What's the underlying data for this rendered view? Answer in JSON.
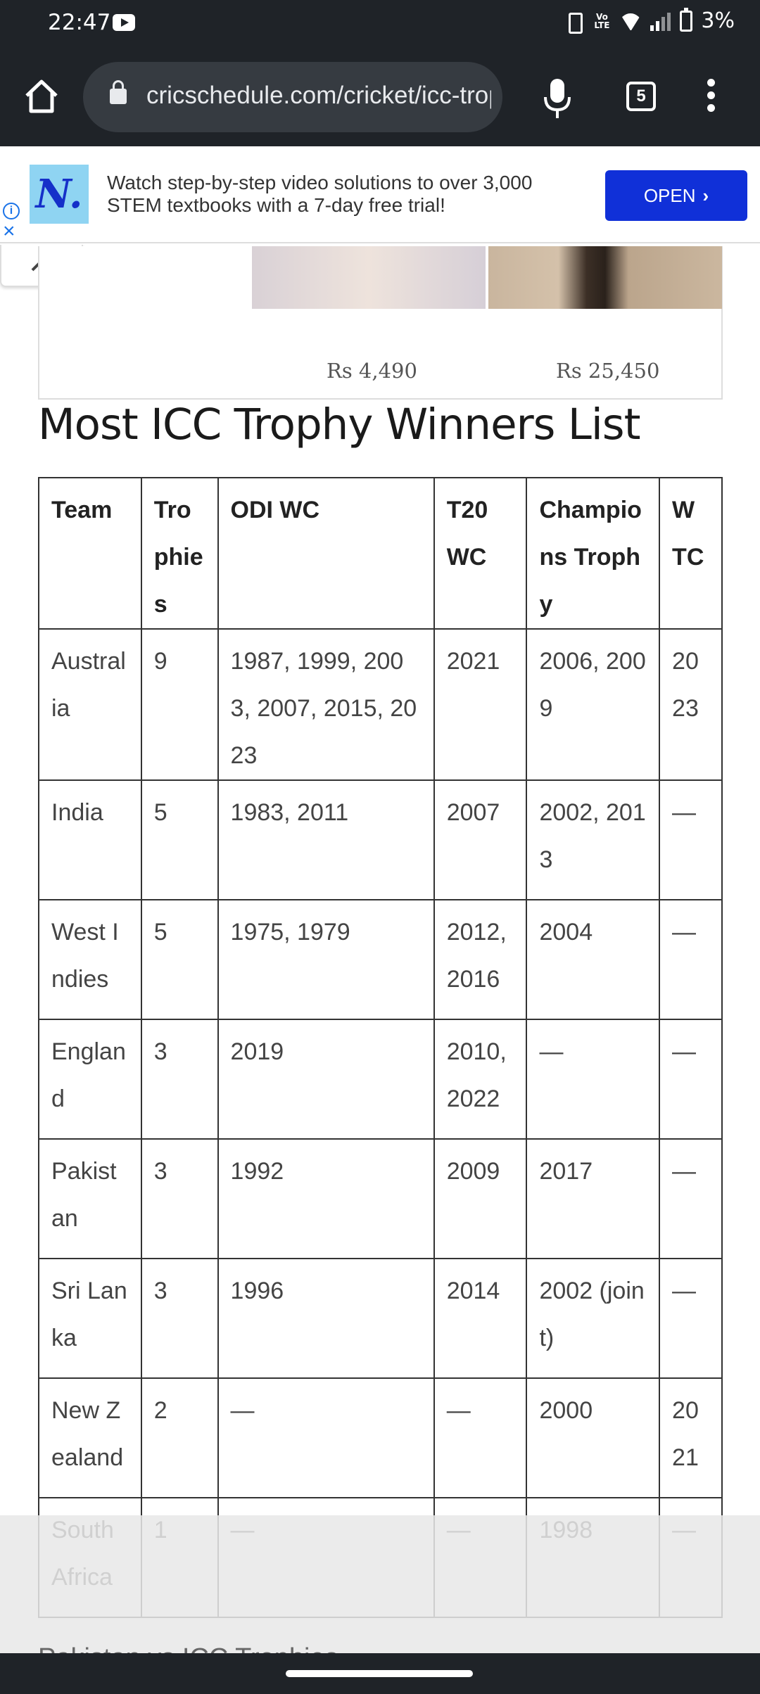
{
  "status_bar": {
    "time": "22:47",
    "volte": "Vo LTE",
    "battery": "3%",
    "icons": [
      "youtube-icon",
      "vibrate-icon",
      "volte-icon",
      "wifi-icon",
      "signal-icon",
      "battery-icon"
    ]
  },
  "browser": {
    "url": "cricschedule.com/cricket/icc-trophy",
    "tab_count": "5",
    "icons": [
      "home-icon",
      "lock-icon",
      "mic-icon",
      "tabs-icon",
      "more-vert-icon"
    ]
  },
  "ad": {
    "logo": "N.",
    "text": "Watch step-by-step video solutions to over 3,000 STEM textbooks with a 7-day free trial!",
    "cta": "OPEN",
    "colors": {
      "cta": "#1030d8",
      "logo_bg": "#8fd4f2"
    }
  },
  "product_ad": {
    "prices": [
      "Rs 4,490",
      "Rs 25,450"
    ]
  },
  "article": {
    "heading": "Most ICC Trophy Winners List",
    "table": {
      "headers": [
        "Team",
        "Trophies",
        "ODI WC",
        "T20 WC",
        "Champions Trophy",
        "WTC"
      ],
      "rows": [
        [
          "Australia",
          "9",
          "1987, 1999, 2003, 2007, 2015, 2023",
          "2021",
          "2006, 2009",
          "2023"
        ],
        [
          "India",
          "5",
          "1983, 2011",
          "2007",
          "2002, 2013",
          "—"
        ],
        [
          "West Indies",
          "5",
          "1975, 1979",
          "2012, 2016",
          "2004",
          "—"
        ],
        [
          "England",
          "3",
          "2019",
          "2010, 2022",
          "—",
          "—"
        ],
        [
          "Pakistan",
          "3",
          "1992",
          "2009",
          "2017",
          "—"
        ],
        [
          "Sri Lanka",
          "3",
          "1996",
          "2014",
          "2002 (joint)",
          "—"
        ],
        [
          "New Zealand",
          "2",
          "—",
          "—",
          "2000",
          "2021"
        ],
        [
          "South Africa",
          "1",
          "—",
          "—",
          "1998",
          "—"
        ]
      ]
    },
    "next_heading": "Pakistan vs ICC Trophies"
  }
}
